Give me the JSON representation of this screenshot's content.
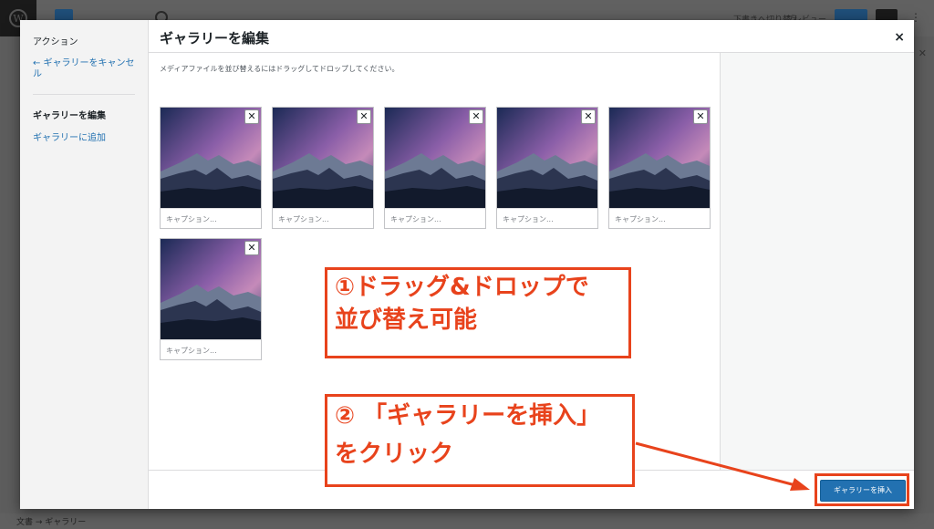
{
  "background": {
    "topbar": {
      "draft_label": "下書きへ切り替え",
      "preview_label": "プレビュー",
      "more_glyph": "⋮"
    },
    "close_glyph": "✕",
    "breadcrumb": "文書 → ギャラリー"
  },
  "modal": {
    "title": "ギャラリーを編集",
    "close_glyph": "×",
    "instructions": "メディアファイルを並び替えるにはドラッグしてドロップしてください。",
    "menu": {
      "heading": "アクション",
      "cancel_link": "← ギャラリーをキャンセル",
      "active_item": "ギャラリーを編集",
      "add_item": "ギャラリーに追加"
    },
    "thumbnails": [
      {
        "caption_placeholder": "キャプション..."
      },
      {
        "caption_placeholder": "キャプション..."
      },
      {
        "caption_placeholder": "キャプション..."
      },
      {
        "caption_placeholder": "キャプション..."
      },
      {
        "caption_placeholder": "キャプション..."
      },
      {
        "caption_placeholder": "キャプション..."
      }
    ],
    "remove_glyph": "✕",
    "insert_button": "ギャラリーを挿入"
  },
  "annotations": {
    "note1_line1": "①ドラッグ&ドロップで",
    "note1_line2": "並び替え可能",
    "note2_line1": "② 「ギャラリーを挿入」",
    "note2_line2": "をクリック",
    "color": "#e8431c"
  },
  "colors": {
    "accent": "#2271b1",
    "annotation": "#e8431c"
  }
}
